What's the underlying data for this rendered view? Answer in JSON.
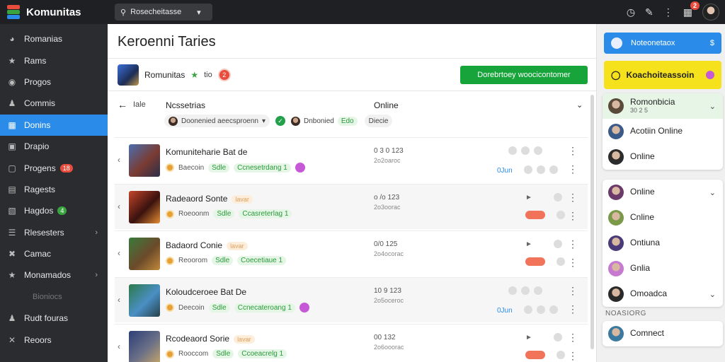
{
  "app": {
    "name": "Komunitas",
    "search_placeholder": "Rosecheitasse",
    "notification_count": "2",
    "brand_colors": {
      "accent": "#2a8ce8",
      "green": "#17a43a",
      "yellow": "#f5e21c",
      "red": "#e74c3c"
    }
  },
  "sidebar": {
    "items": [
      {
        "label": "Romanias",
        "icon": "gauge-icon"
      },
      {
        "label": "Rams",
        "icon": "star-icon"
      },
      {
        "label": "Progos",
        "icon": "target-icon"
      },
      {
        "label": "Commis",
        "icon": "users-icon"
      },
      {
        "label": "Donins",
        "icon": "grid-icon",
        "active": true
      },
      {
        "label": "Drapio",
        "icon": "image-icon"
      },
      {
        "label": "Progens",
        "icon": "tv-icon",
        "badge": "18"
      },
      {
        "label": "Ragests",
        "icon": "chart-icon"
      },
      {
        "label": "Hagdos",
        "icon": "folder-icon",
        "badge": "4"
      },
      {
        "label": "Rlesesters",
        "icon": "list-icon",
        "chevron": true
      },
      {
        "label": "Camac",
        "icon": "wrench-icon"
      },
      {
        "label": "Monamados",
        "icon": "star-icon",
        "chevron": true
      },
      {
        "label": "Bioniocs",
        "icon": "",
        "muted": true
      },
      {
        "label": "Rudt fouras",
        "icon": "users-icon"
      },
      {
        "label": "Reoors",
        "icon": "close-icon"
      }
    ]
  },
  "main": {
    "title": "Keroenni Taries",
    "group": {
      "name": "Romunitas",
      "suffix": "tio",
      "count": "2",
      "action_label": "Dorebrtoey woocicontomer"
    },
    "table": {
      "back_label": "Iale",
      "col_name": "Ncssetrias",
      "col_status": "Online",
      "filter_chip": "Doonenied aeecsproenn",
      "owner_chip": "Dnbonied",
      "owner_tag": "Edo",
      "status_chip": "Diecie"
    },
    "rows": [
      {
        "name": "Komuniteharie Bat de",
        "sub": "Baecoin",
        "chip1": "Sdle",
        "chip2": "Ccnesetrdang 1",
        "n1": "0 3 0 123",
        "n2": "2o2oaroc",
        "status": "0Jun",
        "thumb": "linear-gradient(135deg,#4a6fb0,#7a3b32 55%,#2b2f48)"
      },
      {
        "name": "Radeaord Sonte",
        "sub": "Roeoonm",
        "chip1": "Sdle",
        "chip2": "Ccasreterlag 1",
        "n1": "o /o 123",
        "n2": "2o3oorac",
        "status": "",
        "tag": "lavar",
        "thumb": "linear-gradient(135deg,#c4462b,#3a120e 55%,#e58c32)"
      },
      {
        "name": "Badaord Conie",
        "sub": "Reoorom",
        "chip1": "Sdle",
        "chip2": "Coecetiaue 1",
        "n1": "0/0 125",
        "n2": "2o4ocorac",
        "status": "",
        "tag": "lavar",
        "thumb": "linear-gradient(135deg,#3a7a3d,#6b4a2a 55%,#c1893b)"
      },
      {
        "name": "Koloudceroee Bat De",
        "sub": "Deecoin",
        "chip1": "Sdle",
        "chip2": "Ccnecateroang 1",
        "n1": "10 9 123",
        "n2": "2o5oceroc",
        "status": "0Jun",
        "thumb": "linear-gradient(135deg,#2d7a4a,#4a8fc4 55%,#27414a)"
      },
      {
        "name": "Rcodeaord Sorie",
        "sub": "Rooccom",
        "chip1": "Sdle",
        "chip2": "Ccoeacrelg 1",
        "n1": "00 132",
        "n2": "2o6ooorac",
        "status": "",
        "tag": "lavar",
        "thumb": "linear-gradient(135deg,#2c3f78,#6a6f87 55%,#c2a46a)"
      }
    ]
  },
  "right": {
    "blue_button": "Noteonetaox",
    "yellow_button": "Koachoiteassoin",
    "card1": [
      {
        "label": "Romonbicia",
        "sub": "30 2 5",
        "av": "#5a4a3a",
        "green": true,
        "chevron": true
      },
      {
        "label": "Acotiin Online",
        "av": "#3a5a8a"
      },
      {
        "label": "Online",
        "av": "#2c2c2c"
      }
    ],
    "card2": [
      {
        "label": "Online",
        "av": "#6b3a6a",
        "chevron": true
      },
      {
        "label": "Cnline",
        "av": "#7a9a4a"
      },
      {
        "label": "Ontiuna",
        "av": "#4a3a7a"
      },
      {
        "label": "Gnlia",
        "av": "#c67ad0"
      },
      {
        "label": "Omoadca",
        "av": "#2a2a2a",
        "chevron": true
      }
    ],
    "section_label": "NOASIORG",
    "card3": [
      {
        "label": "Comnect",
        "av": "#3a7aa0"
      }
    ]
  }
}
